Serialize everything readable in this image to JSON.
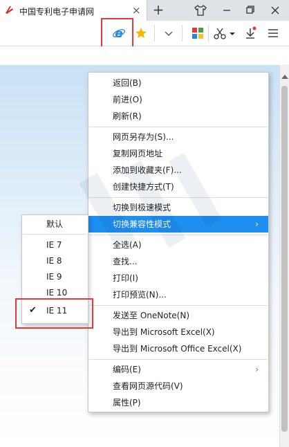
{
  "tab": {
    "title": "中国专利电子申请网",
    "close": "×"
  },
  "newtab": "+",
  "colors": {
    "accent": "#1e8ef0",
    "highlight_box": "#e53935",
    "ie_blue": "#1e88e5",
    "star": "#f5b800"
  },
  "icons": [
    "tab-favicon-icon",
    "close-icon",
    "plus-icon",
    "shirt-icon",
    "minimize-icon",
    "maximize-icon",
    "close-window-icon",
    "ie-icon",
    "star-icon",
    "chevron-down-icon",
    "apps-grid-icon",
    "scissors-icon",
    "download-icon",
    "menu-icon",
    "checkmark-icon",
    "chevron-right-icon"
  ],
  "menu": {
    "items": [
      "返回(B)",
      "前进(O)",
      "刷新(R)",
      "网页另存为(S)...",
      "复制网页地址",
      "添加到收藏夹(F)...",
      "创建快捷方式(T)",
      "切换到极速模式",
      "切换兼容性模式",
      "全选(A)",
      "查找...",
      "打印(I)",
      "打印预览(N)...",
      "发送至 OneNote(N)",
      "导出到 Microsoft Excel(X)",
      "导出到 Microsoft Office Excel(X)",
      "编码(E)",
      "查看网页源代码(V)",
      "属性(P)"
    ],
    "arrow": "›"
  },
  "submenu": {
    "items": [
      "默认",
      "IE 7",
      "IE 8",
      "IE 9",
      "IE 10",
      "IE 11"
    ],
    "checked": "✔"
  }
}
